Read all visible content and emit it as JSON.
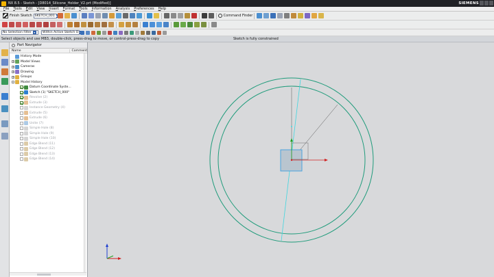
{
  "window": {
    "title": "NX 8.5 - Sketch - [D8014_Silicone_Holder_V2.prt (Modified)]",
    "brand": "SIEMENS"
  },
  "menu": [
    {
      "label": "File",
      "key": "F",
      "rest": "ile"
    },
    {
      "label": "Tools",
      "key": "T",
      "rest": "ools"
    },
    {
      "label": "Edit",
      "key": "E",
      "rest": "dit"
    },
    {
      "label": "View",
      "key": "V",
      "rest": "iew"
    },
    {
      "label": "Insert",
      "key": "I",
      "rest": "nsert"
    },
    {
      "label": "Format",
      "key": "F",
      "rest": "ormat"
    },
    {
      "label": "Tools",
      "key": "T",
      "rest": "ools"
    },
    {
      "label": "Information",
      "key": "I",
      "rest": "nformation"
    },
    {
      "label": "Analysis",
      "key": "A",
      "rest": "nalysis"
    },
    {
      "label": "Preferences",
      "key": "P",
      "rest": "references"
    },
    {
      "label": "Help",
      "key": "H",
      "rest": "elp"
    }
  ],
  "toolbar": {
    "finish_sketch": "Finish Sketch",
    "sketch_name": "SKETCH_001",
    "command_finder": "Command Finder",
    "selection_filter": "No Selection Filter",
    "selection_scope": "Within Active Sketch O"
  },
  "cue": {
    "prompt": "Select objects and use MB3, double-click, press-drag to move, or control-press-drag to copy",
    "status": "Sketch is fully constrained"
  },
  "navigator": {
    "title": "Part Navigator",
    "col_name": "Name",
    "col_comment": "Comment",
    "items": [
      {
        "label": "History Mode",
        "indent": 0,
        "icon": "#5a9bd8",
        "expander": "",
        "check": false,
        "dim": false
      },
      {
        "label": "Model Views",
        "indent": 0,
        "icon": "#63a35a",
        "expander": "+",
        "check": false,
        "dim": false
      },
      {
        "label": "Cameras",
        "indent": 0,
        "icon": "#4a8fc9",
        "expander": "+",
        "check": false,
        "dim": false
      },
      {
        "label": "Drawing",
        "indent": 0,
        "icon": "#8a6fc9",
        "expander": "+",
        "check": false,
        "dim": false
      },
      {
        "label": "Groups",
        "indent": 0,
        "icon": "#e0b040",
        "expander": "+",
        "check": false,
        "dim": false
      },
      {
        "label": "Model History",
        "indent": 0,
        "icon": "#e0b040",
        "expander": "-",
        "check": false,
        "dim": false
      },
      {
        "label": "Datum Coordinate Syste...",
        "indent": 1,
        "icon": "#3f8a3f",
        "expander": "",
        "check": true,
        "dim": false
      },
      {
        "label": "Sketch (1) \"SKETCH_000\"",
        "indent": 1,
        "icon": "#2d7fd0",
        "expander": "",
        "check": true,
        "dim": false
      },
      {
        "label": "Revolve (2)",
        "indent": 1,
        "icon": "#d08a3a",
        "expander": "",
        "check": true,
        "dim": true
      },
      {
        "label": "Extrude (3)",
        "indent": 1,
        "icon": "#d08a3a",
        "expander": "",
        "check": true,
        "dim": true
      },
      {
        "label": "Instance Geometry (4)",
        "indent": 1,
        "icon": "#b0b0b0",
        "expander": "",
        "check": false,
        "dim": true
      },
      {
        "label": "Extrude (5)",
        "indent": 1,
        "icon": "#d08a3a",
        "expander": "",
        "check": false,
        "dim": true
      },
      {
        "label": "Extrude (6)",
        "indent": 1,
        "icon": "#d08a3a",
        "expander": "",
        "check": false,
        "dim": true
      },
      {
        "label": "Unite (7)",
        "indent": 1,
        "icon": "#6a9fd0",
        "expander": "",
        "check": false,
        "dim": true
      },
      {
        "label": "Simple Hole (8)",
        "indent": 1,
        "icon": "#b0b0b0",
        "expander": "",
        "check": false,
        "dim": true
      },
      {
        "label": "Simple Hole (9)",
        "indent": 1,
        "icon": "#b0b0b0",
        "expander": "",
        "check": false,
        "dim": true
      },
      {
        "label": "Simple Hole (10)",
        "indent": 1,
        "icon": "#b0b0b0",
        "expander": "",
        "check": false,
        "dim": true
      },
      {
        "label": "Edge Blend (11)",
        "indent": 1,
        "icon": "#c0a060",
        "expander": "",
        "check": false,
        "dim": true
      },
      {
        "label": "Edge Blend (12)",
        "indent": 1,
        "icon": "#c0a060",
        "expander": "",
        "check": false,
        "dim": true
      },
      {
        "label": "Edge Blend (13)",
        "indent": 1,
        "icon": "#c0a060",
        "expander": "",
        "check": false,
        "dim": true
      },
      {
        "label": "Edge Blend (14)",
        "indent": 1,
        "icon": "#c0a060",
        "expander": "",
        "check": false,
        "dim": true
      }
    ]
  },
  "colors": {
    "sketch_curve": "#1e9b7a",
    "construction_line": "#3fd6e0",
    "datum_box": "#4aa3df",
    "triad_x": "#d02020",
    "triad_y": "#20a020",
    "triad_z": "#2040d0"
  }
}
